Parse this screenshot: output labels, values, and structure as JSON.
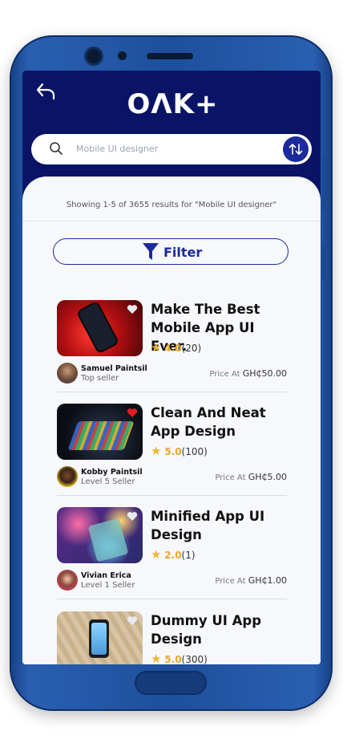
{
  "app": {
    "logo": "OΛK+"
  },
  "search": {
    "placeholder": "Mobile UI designer"
  },
  "results": {
    "text": "Showing 1-5 of 3655 results for \"Mobile UI designer\""
  },
  "filter": {
    "label": "Filter"
  },
  "listings": [
    {
      "title": "Make The Best Mobile App UI Ever.",
      "rating": "4.0",
      "reviews": "(20)",
      "seller": "Samuel Paintsil",
      "level": "Top seller",
      "price_label": "Price At",
      "price": "GH₵50.00",
      "favorited": false
    },
    {
      "title": "Clean And Neat App Design",
      "rating": "5.0",
      "reviews": "(100)",
      "seller": "Kobby Paintsil",
      "level": "Level 5 Seller",
      "price_label": "Price At",
      "price": "GH₵5.00",
      "favorited": true
    },
    {
      "title": "Minified App UI Design",
      "rating": "2.0",
      "reviews": "(1)",
      "seller": "Vivian Erica",
      "level": "Level 1 Seller",
      "price_label": "Price At",
      "price": "GH₵1.00",
      "favorited": false
    },
    {
      "title": "Dummy UI App Design",
      "rating": "5.0",
      "reviews": "(300)",
      "seller": "",
      "level": "",
      "price_label": "",
      "price": "",
      "favorited": false
    }
  ],
  "colors": {
    "header": "#0a1466",
    "accent": "#1b2a9c",
    "star": "#f2b531",
    "heart_active": "#e31b23"
  },
  "icons": [
    "back-icon",
    "search-icon",
    "sort-icon",
    "filter-icon",
    "heart-icon",
    "star-icon"
  ]
}
